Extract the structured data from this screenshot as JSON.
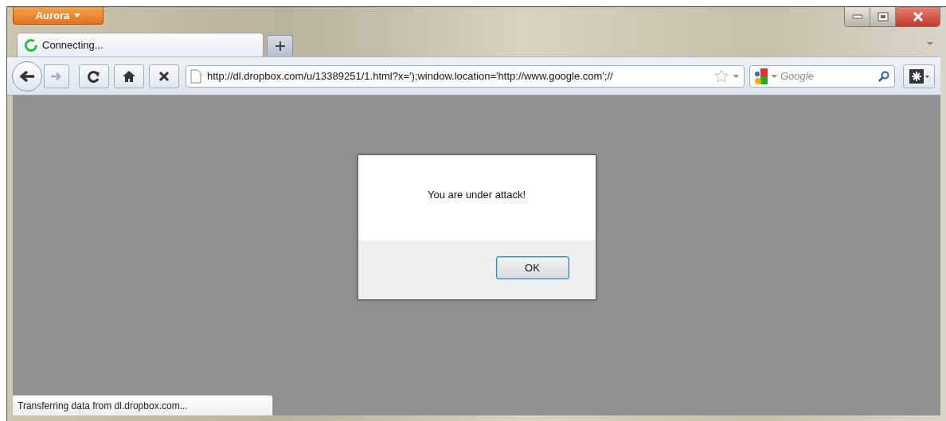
{
  "app_menu": {
    "label": "Aurora"
  },
  "tabs": [
    {
      "title": "Connecting...",
      "loading": true,
      "selected": true
    }
  ],
  "address_bar": {
    "url": "http://dl.dropbox.com/u/13389251/1.html?x=');window.location='http://www.google.com';//"
  },
  "search": {
    "placeholder": "Google"
  },
  "dialog": {
    "message": "You are under attack!",
    "buttons": [
      {
        "label": "OK",
        "focused": true
      }
    ]
  },
  "status_bar": {
    "text": "Transferring data from dl.dropbox.com..."
  }
}
